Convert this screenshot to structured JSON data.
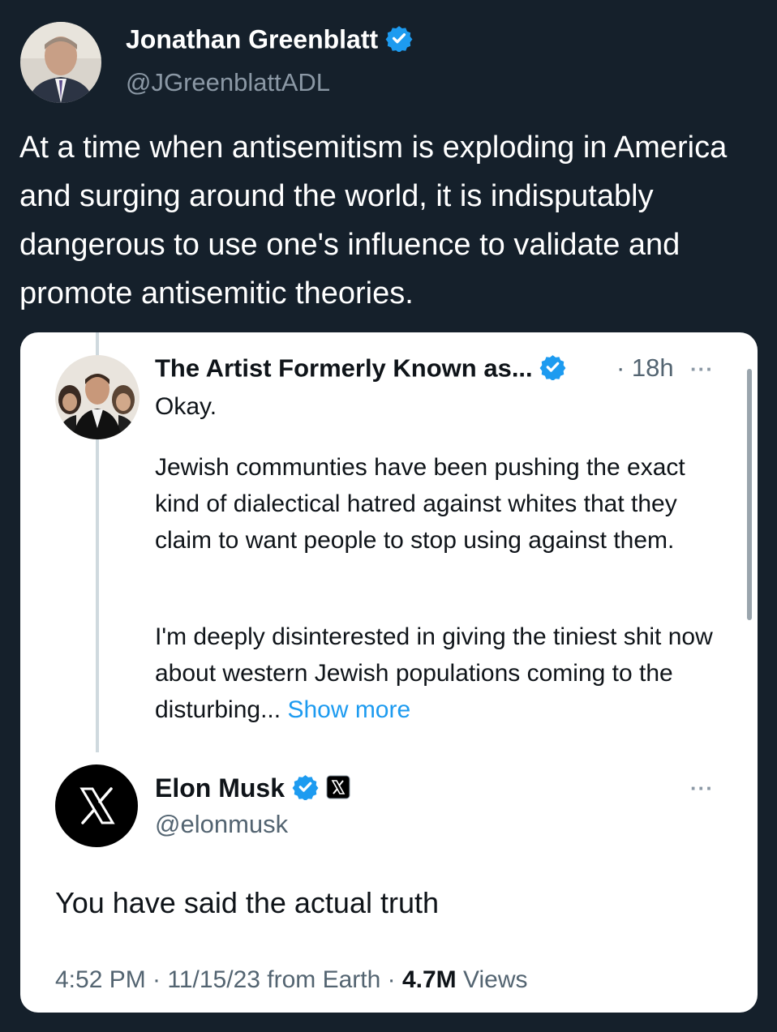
{
  "tweet": {
    "author_name": "Jonathan Greenblatt",
    "author_handle": "@JGreenblattADL",
    "text": "At a time when antisemitism is exploding in America and surging around the world, it is indisputably dangerous to use one's influence to validate and promote antisemitic theories."
  },
  "quoted": {
    "original": {
      "author_name": "The Artist Formerly Known as...",
      "time": "· 18h",
      "more": "···",
      "paragraphs": [
        "Okay.",
        "Jewish communties have been pushing the exact kind of dialectical hatred against whites that they claim to want people to stop using against them.",
        "I'm deeply disinterested in giving the tiniest shit now about western Jewish populations coming to the disturbing..."
      ],
      "show_more": "Show more"
    },
    "reply": {
      "author_name": "Elon Musk",
      "author_handle": "@elonmusk",
      "more": "···",
      "text": "You have said the actual truth",
      "meta_time": "4:52 PM · 11/15/23 from Earth · ",
      "views_count": "4.7M",
      "views_label": " Views"
    }
  },
  "colors": {
    "background": "#15202b",
    "card": "#ffffff",
    "verified": "#1d9bf0",
    "link": "#1d9bf0"
  },
  "icons": [
    "verified-badge-icon",
    "x-logo-icon",
    "more-icon"
  ]
}
